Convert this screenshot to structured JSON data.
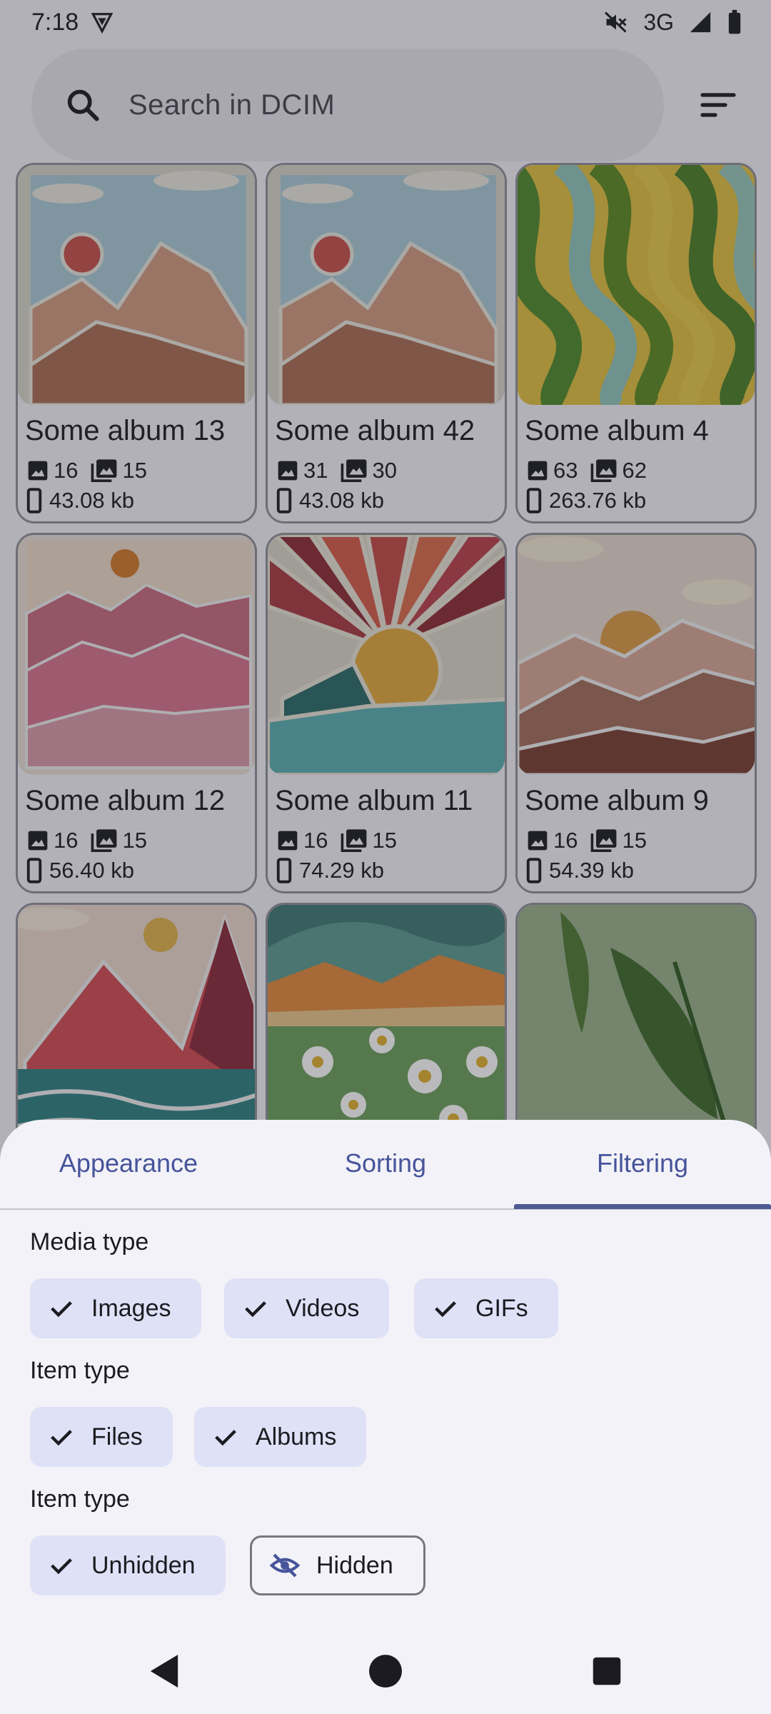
{
  "status": {
    "time": "7:18",
    "network": "3G"
  },
  "search": {
    "placeholder": "Search in DCIM"
  },
  "albums": [
    {
      "title": "Some album 13",
      "images": "16",
      "media": "15",
      "size": "43.08 kb",
      "art": "mountain-sun"
    },
    {
      "title": "Some album 42",
      "images": "31",
      "media": "30",
      "size": "43.08 kb",
      "art": "mountain-sun"
    },
    {
      "title": "Some album 4",
      "images": "63",
      "media": "62",
      "size": "263.76 kb",
      "art": "waves"
    },
    {
      "title": "Some album 12",
      "images": "16",
      "media": "15",
      "size": "56.40 kb",
      "art": "pink-hills"
    },
    {
      "title": "Some album 11",
      "images": "16",
      "media": "15",
      "size": "74.29 kb",
      "art": "sunburst"
    },
    {
      "title": "Some album 9",
      "images": "16",
      "media": "15",
      "size": "54.39 kb",
      "art": "desert-sun"
    },
    {
      "art": "red-mountain"
    },
    {
      "art": "daisy-meadow"
    },
    {
      "art": "leaves"
    }
  ],
  "sheet": {
    "tabs": [
      "Appearance",
      "Sorting",
      "Filtering"
    ],
    "active_tab": "Filtering",
    "media_type_label": "Media type",
    "media_types": [
      "Images",
      "Videos",
      "GIFs"
    ],
    "item_type_label": "Item type",
    "item_types": [
      "Files",
      "Albums"
    ],
    "visibility_label": "Item type",
    "visibility": [
      {
        "label": "Unhidden",
        "selected": true
      },
      {
        "label": "Hidden",
        "selected": false
      }
    ]
  },
  "colors": {
    "accent": "#4d5a92",
    "chip_bg": "#dfe1f6",
    "surface": "#f3f2f8"
  }
}
